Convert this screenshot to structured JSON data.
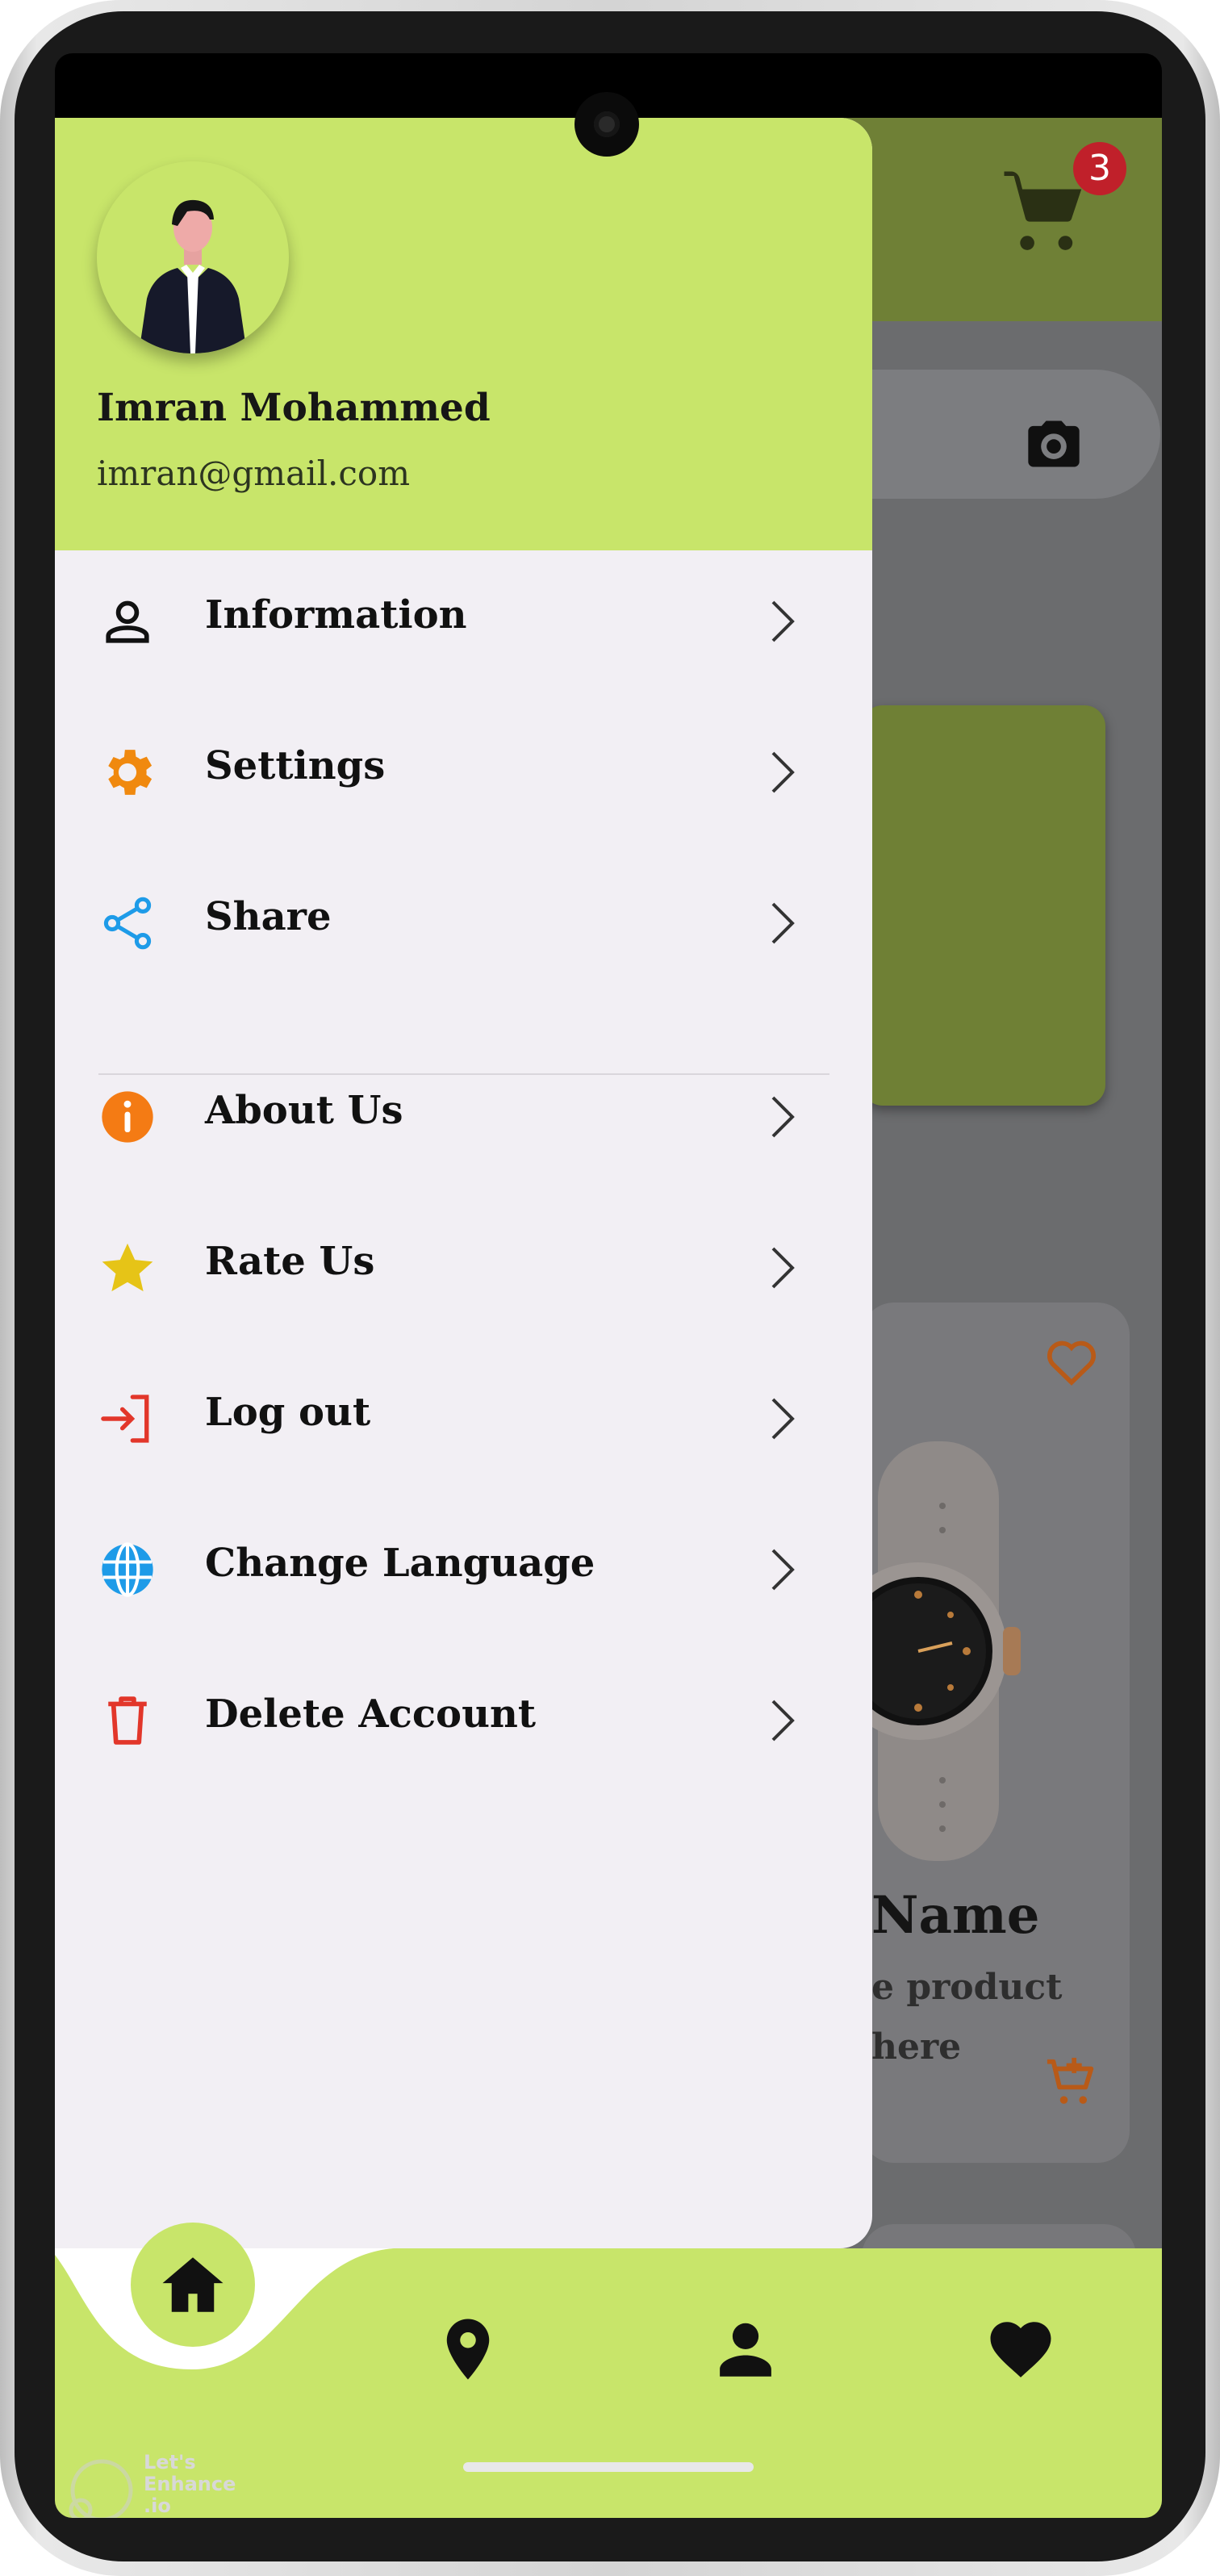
{
  "header": {
    "cart_badge": "3",
    "cart_icon": "cart-icon",
    "camera_icon": "camera-icon"
  },
  "profile": {
    "name": "Imran Mohammed",
    "email": "imran@gmail.com"
  },
  "menu_primary": [
    {
      "label": "Information",
      "icon": "person-icon",
      "icon_color": "#111111"
    },
    {
      "label": "Settings",
      "icon": "gear-icon",
      "icon_color": "#f0890f"
    },
    {
      "label": "Share",
      "icon": "share-icon",
      "icon_color": "#1e9be8"
    }
  ],
  "menu_secondary": [
    {
      "label": "About Us",
      "icon": "info-icon",
      "icon_color": "#f47b14"
    },
    {
      "label": "Rate Us",
      "icon": "star-icon",
      "icon_color": "#e6c417"
    },
    {
      "label": "Log out",
      "icon": "logout-icon",
      "icon_color": "#e2362a"
    },
    {
      "label": "Change Language",
      "icon": "globe-icon",
      "icon_color": "#1e9be8"
    },
    {
      "label": "Delete Account",
      "icon": "trash-icon",
      "icon_color": "#e2362a"
    }
  ],
  "product": {
    "name": "Name",
    "description_line1": "e product",
    "description_line2": "here",
    "favorite_icon": "heart-outline-icon",
    "add_to_cart_icon": "cart-add-icon"
  },
  "bottom_nav": [
    {
      "icon": "home-icon",
      "active": true
    },
    {
      "icon": "location-icon",
      "active": false
    },
    {
      "icon": "user-icon",
      "active": false
    },
    {
      "icon": "heart-icon",
      "active": false
    }
  ],
  "watermark": {
    "line1": "Let's",
    "line2": "Enhance",
    "line3": ".io"
  },
  "colors": {
    "accent": "#c8e56a",
    "drawer_background": "#f2eff4",
    "header_dimmed": "#6f8036",
    "badge": "#c0202a"
  }
}
